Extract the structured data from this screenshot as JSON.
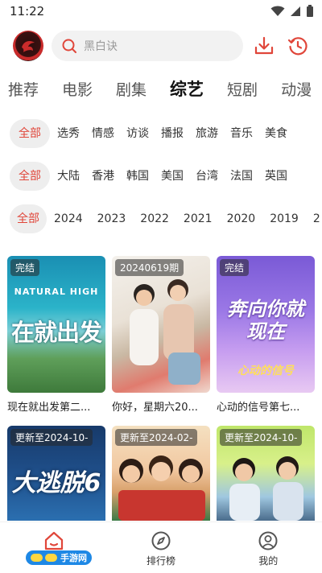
{
  "status_bar": {
    "time": "11:22"
  },
  "search": {
    "placeholder": "黑白诀"
  },
  "category_tabs": [
    {
      "label": "推荐",
      "active": false
    },
    {
      "label": "电影",
      "active": false
    },
    {
      "label": "剧集",
      "active": false
    },
    {
      "label": "综艺",
      "active": true
    },
    {
      "label": "短剧",
      "active": false
    },
    {
      "label": "动漫",
      "active": false
    }
  ],
  "filter_type": [
    "全部",
    "选秀",
    "情感",
    "访谈",
    "播报",
    "旅游",
    "音乐",
    "美食"
  ],
  "filter_region": [
    "全部",
    "大陆",
    "香港",
    "韩国",
    "美国",
    "台湾",
    "法国",
    "英国"
  ],
  "filter_year": [
    "全部",
    "2024",
    "2023",
    "2022",
    "2021",
    "2020",
    "2019",
    "2"
  ],
  "cards": [
    {
      "badge": "完结",
      "title": "现在就出发第二...",
      "poster_text": "在就出发",
      "logo_text": "NATURAL HIGH"
    },
    {
      "badge": "20240619期",
      "title": "你好，星期六20...",
      "poster_text": "",
      "logo_text": ""
    },
    {
      "badge": "完结",
      "title": "心动的信号第七...",
      "poster_text": "奔向你就现在",
      "logo_text": "心动的信号"
    },
    {
      "badge": "更新至2024-10-",
      "title": "",
      "poster_text": "大逃脱6",
      "logo_text": ""
    },
    {
      "badge": "更新至2024-02-",
      "title": "",
      "poster_text": "",
      "logo_text": ""
    },
    {
      "badge": "更新至2024-10-",
      "title": "",
      "poster_text": "",
      "logo_text": ""
    }
  ],
  "bottom_nav": [
    {
      "label": "",
      "icon": "home-icon",
      "active": true
    },
    {
      "label": "排行榜",
      "icon": "compass-icon",
      "active": false
    },
    {
      "label": "我的",
      "icon": "user-icon",
      "active": false
    }
  ],
  "watermark": "手游网",
  "colors": {
    "accent": "#e0463a",
    "chip_bg": "#eeeeee",
    "search_bg": "#f2f2f2"
  }
}
